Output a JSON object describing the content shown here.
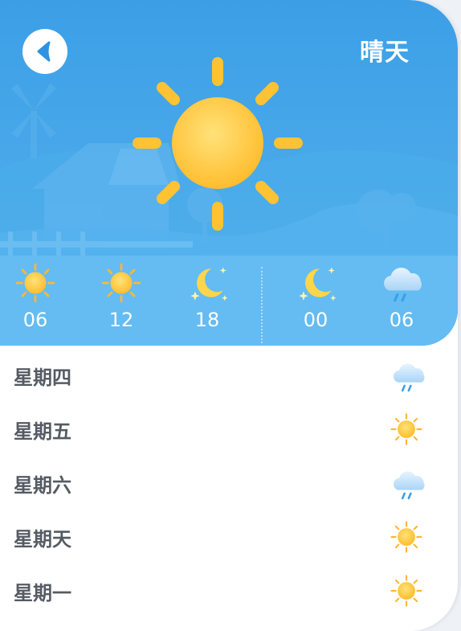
{
  "header": {
    "condition": "晴天",
    "back_icon": "chevron-left-icon",
    "main_icon": "sun-icon"
  },
  "hourly": [
    {
      "time": "06",
      "icon": "sun-icon"
    },
    {
      "time": "12",
      "icon": "sun-icon"
    },
    {
      "time": "18",
      "icon": "moon-icon"
    },
    {
      "time": "00",
      "icon": "moon-icon"
    },
    {
      "time": "06",
      "icon": "rain-cloud-icon"
    }
  ],
  "daily": [
    {
      "day": "星期四",
      "icon": "rain-cloud-icon"
    },
    {
      "day": "星期五",
      "icon": "sun-icon"
    },
    {
      "day": "星期六",
      "icon": "rain-cloud-icon"
    },
    {
      "day": "星期天",
      "icon": "sun-icon"
    },
    {
      "day": "星期一",
      "icon": "sun-icon"
    }
  ],
  "colors": {
    "sky": "#3c9fe6",
    "sun": "#ffc233",
    "moon": "#ffd54a",
    "text": "#555b63"
  }
}
